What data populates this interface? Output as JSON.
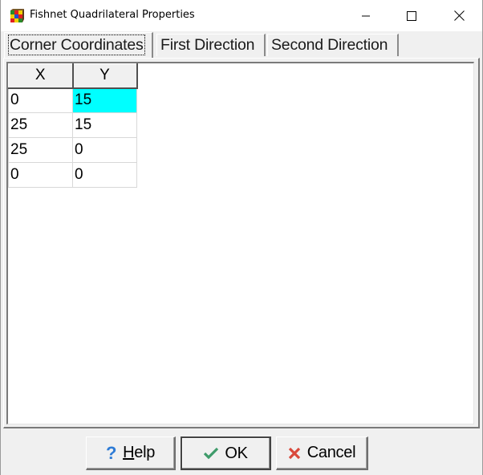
{
  "window": {
    "title": "Fishnet Quadrilateral Properties",
    "icon": "fishnet-app-icon",
    "controls": {
      "minimize": "minimize-icon",
      "maximize": "maximize-icon",
      "close": "close-icon"
    }
  },
  "tabs": [
    {
      "label": "Corner Coordinates",
      "active": true
    },
    {
      "label": "First Direction",
      "active": false
    },
    {
      "label": "Second Direction",
      "active": false
    }
  ],
  "grid": {
    "columns": [
      "X",
      "Y"
    ],
    "rows": [
      [
        "0",
        "15"
      ],
      [
        "25",
        "15"
      ],
      [
        "25",
        "0"
      ],
      [
        "0",
        "0"
      ]
    ],
    "selected_cell": {
      "row": 0,
      "col": 1
    },
    "selection_color": "#00ffff"
  },
  "buttons": {
    "help": {
      "label_mnemonic": "H",
      "label_rest": "elp",
      "icon": "question-icon"
    },
    "ok": {
      "label": "OK",
      "icon": "checkmark-icon"
    },
    "cancel": {
      "label": "Cancel",
      "icon": "x-icon"
    }
  }
}
